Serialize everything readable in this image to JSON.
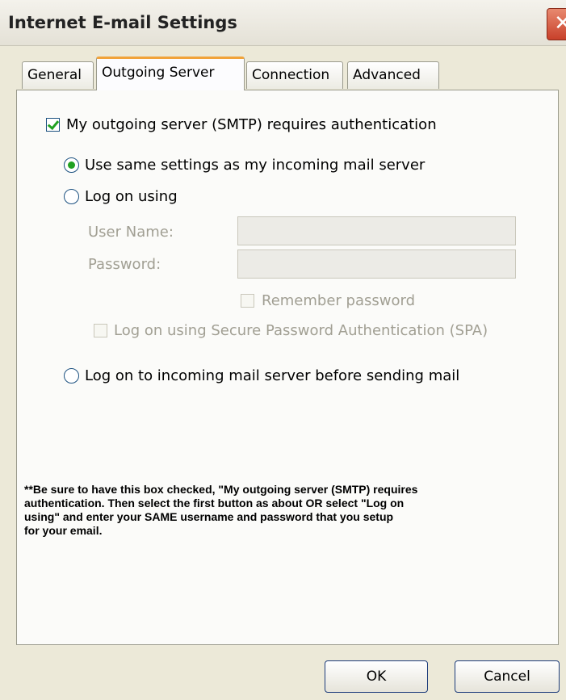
{
  "window": {
    "title": "Internet E-mail Settings",
    "close_glyph": "✕"
  },
  "tabs": [
    {
      "label": "General",
      "active": false
    },
    {
      "label": "Outgoing Server",
      "active": true
    },
    {
      "label": "Connection",
      "active": false
    },
    {
      "label": "Advanced",
      "active": false
    }
  ],
  "outgoing": {
    "requires_auth": {
      "label": "My outgoing server (SMTP) requires authentication",
      "checked": true
    },
    "radio_same": {
      "label": "Use same settings as my incoming mail server",
      "selected": true
    },
    "radio_logon": {
      "label": "Log on using",
      "selected": false
    },
    "username": {
      "label": "User Name:",
      "value": ""
    },
    "password": {
      "label": "Password:",
      "value": ""
    },
    "remember": {
      "label": "Remember password",
      "checked": false
    },
    "spa": {
      "label": "Log on using Secure Password Authentication (SPA)",
      "checked": false
    },
    "radio_incoming": {
      "label": "Log on to incoming mail server before sending mail",
      "selected": false
    }
  },
  "note": "**Be sure to have this box checked, \"My outgoing server (SMTP) requires\n   authentication.  Then select the first button as about OR select \"Log on\n   using\" and enter your SAME username and password that you setup\n   for your email.",
  "buttons": {
    "ok": "OK",
    "cancel": "Cancel"
  },
  "colors": {
    "check": "#21a121",
    "active_tab_accent": "#f1a33a"
  }
}
